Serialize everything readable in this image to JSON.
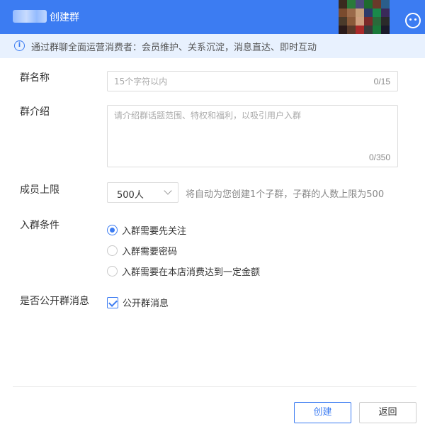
{
  "dialog": {
    "title": "创建群",
    "notice": "通过群聊全面运营消费者：会员维护、关系沉淀，消息直达、即时互动"
  },
  "form": {
    "name": {
      "label": "群名称",
      "placeholder": "15个字符以内",
      "counter": "0/15"
    },
    "intro": {
      "label": "群介绍",
      "placeholder": "请介绍群话题范围、特权和福利，以吸引用户入群",
      "counter": "0/350"
    },
    "limit": {
      "label": "成员上限",
      "value": "500人",
      "hint": "将自动为您创建1个子群，子群的人数上限为500"
    },
    "conditions": {
      "label": "入群条件",
      "options": [
        {
          "label": "入群需要先关注",
          "checked": true
        },
        {
          "label": "入群需要密码",
          "checked": false
        },
        {
          "label": "入群需要在本店消费达到一定金额",
          "checked": false
        }
      ]
    },
    "public_msg": {
      "label": "是否公开群消息",
      "checkbox_label": "公开群消息",
      "checked": true
    }
  },
  "footer": {
    "create_label": "创建",
    "back_label": "返回"
  },
  "colors": {
    "accent": "#3c7cf2",
    "notice_bg": "#e8f1fe"
  }
}
